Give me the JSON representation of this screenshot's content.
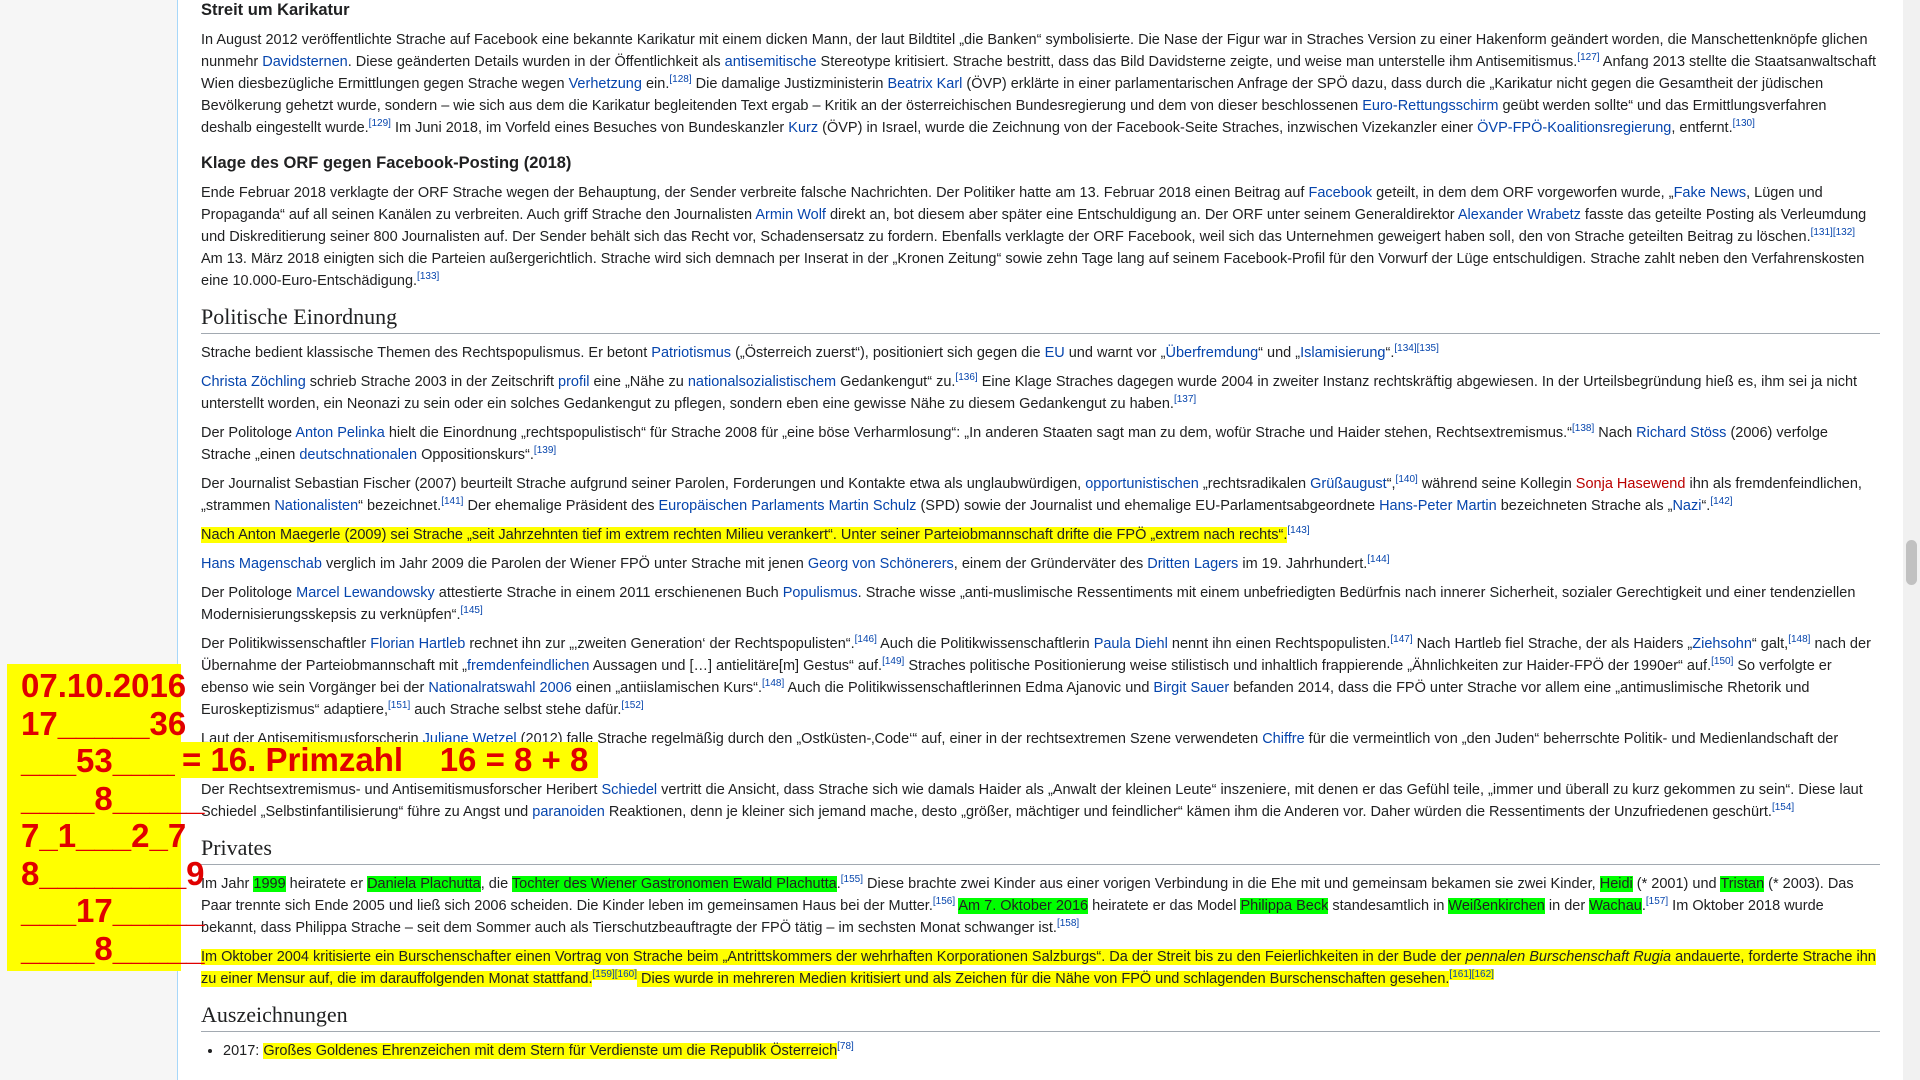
{
  "sections": {
    "karikatur": {
      "title": "Streit um Karikatur",
      "p1": [
        {
          "t": "In August 2012 veröffentlichte Strache auf Facebook eine bekannte Karikatur mit einem dicken Mann, der laut Bildtitel „die Banken“ symbolisierte. Die Nase der Figur war in Straches Version zu einer Hakenform geändert worden, die Manschettenknöpfe glichen nunmehr "
        },
        {
          "t": "Davidsternen",
          "l": 1
        },
        {
          "t": ". Diese geänderten Details wurden in der Öffentlichkeit als "
        },
        {
          "t": "antisemitische",
          "l": 1
        },
        {
          "t": " Stereotype kritisiert. Strache bestritt, dass das Bild Davidsterne zeigte, und weise man unterstelle ihm Antisemitismus."
        },
        {
          "t": "[127]",
          "s": 1
        },
        {
          "t": " Anfang 2013 stellte die Staatsanwaltschaft Wien diesbezügliche Ermittlungen gegen Strache wegen "
        },
        {
          "t": "Verhetzung",
          "l": 1
        },
        {
          "t": " ein."
        },
        {
          "t": "[128]",
          "s": 1
        },
        {
          "t": " Die damalige Justizministerin "
        },
        {
          "t": "Beatrix Karl",
          "l": 1
        },
        {
          "t": " (ÖVP) erklärte in einer parlamentarischen Anfrage der SPÖ dazu, dass durch die „Karikatur nicht gegen die Gesamtheit der jüdischen Bevölkerung gehetzt wurde, sondern – wie sich aus dem die Karikatur begleitenden Text ergab – Kritik an der österreichischen Bundesregierung und dem von dieser beschlossenen "
        },
        {
          "t": "Euro-Rettungsschirm",
          "l": 1
        },
        {
          "t": " geübt werden sollte“ und das Ermittlungsverfahren deshalb eingestellt wurde."
        },
        {
          "t": "[129]",
          "s": 1
        },
        {
          "t": " Im Juni 2018, im Vorfeld eines Besuches von Bundeskanzler "
        },
        {
          "t": "Kurz",
          "l": 1
        },
        {
          "t": " (ÖVP) in Israel, wurde die Zeichnung von der Facebook-Seite Straches, inzwischen Vizekanzler einer "
        },
        {
          "t": "ÖVP-FPÖ-Koalitionsregierung",
          "l": 1
        },
        {
          "t": ", entfernt."
        },
        {
          "t": "[130]",
          "s": 1
        }
      ]
    },
    "orf": {
      "title": "Klage des ORF gegen Facebook-Posting (2018)",
      "p1": [
        {
          "t": "Ende Februar 2018 verklagte der ORF Strache wegen der Behauptung, der Sender verbreite falsche Nachrichten. Der Politiker hatte am 13. Februar 2018 einen Beitrag auf "
        },
        {
          "t": "Facebook",
          "l": 1
        },
        {
          "t": " geteilt, in dem dem ORF vorgeworfen wurde, „"
        },
        {
          "t": "Fake News",
          "l": 1
        },
        {
          "t": ", Lügen und Propaganda“ auf all seinen Kanälen zu verbreiten. Auch griff Strache den Journalisten "
        },
        {
          "t": "Armin Wolf",
          "l": 1
        },
        {
          "t": " direkt an, bot diesem aber später eine Entschuldigung an. Der ORF unter seinem Generaldirektor "
        },
        {
          "t": "Alexander Wrabetz",
          "l": 1
        },
        {
          "t": " fasste das geteilte Posting als Verleumdung und Diskreditierung seiner 800 Journalisten auf. Der Sender behält sich das Recht vor, Schadensersatz zu fordern. Ebenfalls verklagte der ORF Facebook, weil sich das Unternehmen geweigert haben soll, den von Strache geteilten Beitrag zu löschen."
        },
        {
          "t": "[131][132]",
          "s": 1
        },
        {
          "t": " Am 13. März 2018 einigten sich die Parteien außergerichtlich. Strache wird sich demnach per Inserat in der „Kronen Zeitung“ sowie zehn Tage lang auf seinem Facebook-Profil für den Vorwurf der Lüge entschuldigen. Strache zahlt neben den Verfahrenskosten eine 10.000-Euro-Entschädigung."
        },
        {
          "t": "[133]",
          "s": 1
        }
      ]
    },
    "politik": {
      "title": "Politische Einordnung",
      "paras": [
        [
          {
            "t": "Strache bedient klassische Themen des Rechtspopulismus. Er betont "
          },
          {
            "t": "Patriotismus",
            "l": 1
          },
          {
            "t": " („Österreich zuerst“), positioniert sich gegen die "
          },
          {
            "t": "EU",
            "l": 1
          },
          {
            "t": " und warnt vor „"
          },
          {
            "t": "Überfremdung",
            "l": 1
          },
          {
            "t": "“ und „"
          },
          {
            "t": "Islamisierung",
            "l": 1
          },
          {
            "t": "“."
          },
          {
            "t": "[134][135]",
            "s": 1
          }
        ],
        [
          {
            "t": "Christa Zöchling",
            "l": 1
          },
          {
            "t": " schrieb Strache 2003 in der Zeitschrift "
          },
          {
            "t": "profil",
            "l": 1
          },
          {
            "t": " eine „Nähe zu "
          },
          {
            "t": "nationalsozialistischem",
            "l": 1
          },
          {
            "t": " Gedankengut“ zu."
          },
          {
            "t": "[136]",
            "s": 1
          },
          {
            "t": " Eine Klage Straches dagegen wurde 2004 in zweiter Instanz rechtskräftig abgewiesen. In der Urteilsbegründung hieß es, ihm sei ja nicht unterstellt worden, ein Neonazi zu sein oder ein solches Gedankengut zu pflegen, sondern eben eine gewisse Nähe zu diesem Gedankengut zu haben."
          },
          {
            "t": "[137]",
            "s": 1
          }
        ],
        [
          {
            "t": "Der Politologe "
          },
          {
            "t": "Anton Pelinka",
            "l": 1
          },
          {
            "t": " hielt die Einordnung „rechtspopulistisch“ für Strache 2008 für „eine böse Verharmlosung“: „In anderen Staaten sagt man zu dem, wofür Strache und Haider stehen, Rechtsextremismus.“"
          },
          {
            "t": "[138]",
            "s": 1
          },
          {
            "t": " Nach "
          },
          {
            "t": "Richard Stöss",
            "l": 1
          },
          {
            "t": " (2006) verfolge Strache „einen "
          },
          {
            "t": "deutschnationalen",
            "l": 1
          },
          {
            "t": " Oppositionskurs“."
          },
          {
            "t": "[139]",
            "s": 1
          }
        ],
        [
          {
            "t": "Der Journalist Sebastian Fischer (2007) beurteilt Strache aufgrund seiner Parolen, Forderungen und Kontakte etwa als unglaubwürdigen, "
          },
          {
            "t": "opportunistischen",
            "l": 1
          },
          {
            "t": " „rechtsradikalen "
          },
          {
            "t": "Grüßaugust",
            "l": 1
          },
          {
            "t": "“,"
          },
          {
            "t": "[140]",
            "s": 1
          },
          {
            "t": " während seine Kollegin "
          },
          {
            "t": "Sonja Hasewend",
            "l": 1,
            "r": 1
          },
          {
            "t": " ihn als fremdenfeindlichen, „strammen "
          },
          {
            "t": "Nationalisten",
            "l": 1
          },
          {
            "t": "“ bezeichnet."
          },
          {
            "t": "[141]",
            "s": 1
          },
          {
            "t": " Der ehemalige Präsident des "
          },
          {
            "t": "Europäischen Parlaments",
            "l": 1
          },
          {
            "t": " "
          },
          {
            "t": "Martin Schulz",
            "l": 1
          },
          {
            "t": " (SPD) sowie der Journalist und ehemalige EU-Parlamentsabgeordnete "
          },
          {
            "t": "Hans-Peter Martin",
            "l": 1
          },
          {
            "t": " bezeichneten Strache als „"
          },
          {
            "t": "Nazi",
            "l": 1
          },
          {
            "t": "“."
          },
          {
            "t": "[142]",
            "s": 1
          }
        ],
        [
          {
            "t": "Nach Anton Maegerle (2009) sei Strache „seit Jahrzehnten tief im extrem rechten Milieu verankert“. Unter seiner Parteiobmannschaft drifte die FPÖ „extrem nach rechts“.",
            "h": "y"
          },
          {
            "t": "[143]",
            "s": 1
          }
        ],
        [
          {
            "t": "Hans Magenschab",
            "l": 1
          },
          {
            "t": " verglich im Jahr 2009 die Parolen der Wiener FPÖ unter Strache mit jenen "
          },
          {
            "t": "Georg von Schönerers",
            "l": 1
          },
          {
            "t": ", einem der Gründerväter des "
          },
          {
            "t": "Dritten Lagers",
            "l": 1
          },
          {
            "t": " im 19. Jahrhundert."
          },
          {
            "t": "[144]",
            "s": 1
          }
        ],
        [
          {
            "t": "Der Politologe "
          },
          {
            "t": "Marcel Lewandowsky",
            "l": 1
          },
          {
            "t": " attestierte Strache in einem 2011 erschienenen Buch "
          },
          {
            "t": "Populismus",
            "l": 1
          },
          {
            "t": ". Strache wisse „anti-muslimische Ressentiments mit einem unbefriedigten Bedürfnis nach innerer Sicherheit, sozialer Gerechtigkeit und einer tendenziellen Modernisierungsskepsis zu verknüpfen“."
          },
          {
            "t": "[145]",
            "s": 1
          }
        ],
        [
          {
            "t": "Der Politikwissenschaftler "
          },
          {
            "t": "Florian Hartleb",
            "l": 1
          },
          {
            "t": " rechnet ihn zur „‚zweiten Generation‘ der Rechtspopulisten“."
          },
          {
            "t": "[146]",
            "s": 1
          },
          {
            "t": " Auch die Politikwissenschaftlerin "
          },
          {
            "t": "Paula Diehl",
            "l": 1
          },
          {
            "t": " nennt ihn einen Rechtspopulisten."
          },
          {
            "t": "[147]",
            "s": 1
          },
          {
            "t": " Nach Hartleb fiel Strache, der als Haiders „"
          },
          {
            "t": "Ziehsohn",
            "l": 1
          },
          {
            "t": "“ galt,"
          },
          {
            "t": "[148]",
            "s": 1
          },
          {
            "t": " nach der Übernahme der Parteiobmannschaft mit „"
          },
          {
            "t": "fremdenfeindlichen",
            "l": 1
          },
          {
            "t": " Aussagen und […] antielitäre[m] Gestus“ auf."
          },
          {
            "t": "[149]",
            "s": 1
          },
          {
            "t": " Straches politische Positionierung weise stilistisch und inhaltlich frappierende „Ähnlichkeiten zur Haider-FPÖ der 1990er“ auf."
          },
          {
            "t": "[150]",
            "s": 1
          },
          {
            "t": " So verfolgte er ebenso wie sein Vorgänger bei der "
          },
          {
            "t": "Nationalratswahl 2006",
            "l": 1
          },
          {
            "t": " einen „antiislamischen Kurs“."
          },
          {
            "t": "[148]",
            "s": 1
          },
          {
            "t": " Auch die Politikwissenschaftlerinnen Edma Ajanovic und "
          },
          {
            "t": "Birgit Sauer",
            "l": 1
          },
          {
            "t": " befanden 2014, dass die FPÖ unter Strache vor allem eine „antimuslimische Rhetorik und Euroskeptizismus“ adaptiere,"
          },
          {
            "t": "[151]",
            "s": 1
          },
          {
            "t": " auch Strache selbst stehe dafür."
          },
          {
            "t": "[152]",
            "s": 1
          }
        ],
        [
          {
            "t": "Laut der Antisemitismusforscherin "
          },
          {
            "t": "Juliane Wetzel",
            "l": 1
          },
          {
            "t": " (2012) falle Strache regelmäßig durch den „Ostküsten-‚Code‘“ auf, einer in der rechtsextremen Szene verwendeten "
          },
          {
            "t": "Chiffre",
            "l": 1
          },
          {
            "t": " für die vermeintlich von „den Juden“ beherrschte Politik- und Medienlandschaft der Vereinigten Staaten."
          },
          {
            "t": "[153]",
            "s": 1
          }
        ],
        [
          {
            "t": "Der Rechtsextremismus- und Antisemitismusforscher Heribert "
          },
          {
            "t": "Schiedel",
            "l": 1
          },
          {
            "t": " vertritt die Ansicht, dass Strache sich wie damals Haider als „Anwalt der kleinen Leute“ inszeniere, mit denen er das Gefühl teile, „immer und überall zu kurz gekommen zu sein“. Diese laut Schiedel „Selbstinfantilisierung“ führe zu Angst und "
          },
          {
            "t": "paranoiden",
            "l": 1
          },
          {
            "t": " Reaktionen, denn je kleiner sich jemand mache, desto „größer, mächtiger und feindlicher“ kämen ihm die Anderen vor. Daher würden die Ressentiments der Unzufriedenen geschürt."
          },
          {
            "t": "[154]",
            "s": 1
          }
        ]
      ]
    },
    "privates": {
      "title": "Privates",
      "paras": [
        [
          {
            "t": "Im Jahr "
          },
          {
            "t": "1999",
            "h": "g"
          },
          {
            "t": " heiratete er "
          },
          {
            "t": "Daniela Plachutta",
            "h": "g"
          },
          {
            "t": ", die "
          },
          {
            "t": "Tochter des Wiener Gastronomen Ewald Plachutta",
            "h": "g"
          },
          {
            "t": "."
          },
          {
            "t": "[155]",
            "s": 1
          },
          {
            "t": " Diese brachte zwei Kinder aus einer vorigen Verbindung in die Ehe mit und gemeinsam bekamen sie zwei Kinder, "
          },
          {
            "t": "Heidi",
            "h": "g"
          },
          {
            "t": " (* 2001) und "
          },
          {
            "t": "Tristan",
            "h": "g"
          },
          {
            "t": " (* 2003). Das Paar trennte sich Ende 2005 und ließ sich 2006 scheiden. Die Kinder leben im gemeinsamen Haus bei der Mutter."
          },
          {
            "t": "[156]",
            "s": 1
          },
          {
            "t": " "
          },
          {
            "t": "Am 7. Oktober 2016",
            "h": "g"
          },
          {
            "t": " heiratete er das Model "
          },
          {
            "t": "Philippa Beck",
            "h": "g"
          },
          {
            "t": " standesamtlich in "
          },
          {
            "t": "Weißenkirchen",
            "h": "g"
          },
          {
            "t": " in der "
          },
          {
            "t": "Wachau",
            "h": "g"
          },
          {
            "t": "."
          },
          {
            "t": "[157]",
            "s": 1
          },
          {
            "t": " Im Oktober 2018 wurde bekannt, dass Philippa Strache – seit dem Sommer auch als Tierschutzbeauftragte der FPÖ tätig – im sechsten Monat schwanger ist."
          },
          {
            "t": "[158]",
            "s": 1
          }
        ],
        [
          {
            "t": "Im Oktober 2004 kritisierte ein Burschenschafter einen Vortrag von Strache beim „Antrittskommers der wehrhaften Korporationen Salzburgs“. Da der Streit bis zu den Feierlichkeiten in der Bude der ",
            "h": "y"
          },
          {
            "t": "pennalen Burschenschaft Rugia",
            "h": "y",
            "i": 1
          },
          {
            "t": " andauerte, forderte Strache ihn zu einer Mensur auf, die im darauffolgenden Monat stattfand.",
            "h": "y"
          },
          {
            "t": "[159][160]",
            "s": 1,
            "h": "y"
          },
          {
            "t": " Dies wurde in mehreren Medien kritisiert und als Zeichen für die Nähe von FPÖ und schlagenden Burschenschaften gesehen.",
            "h": "y"
          },
          {
            "t": "[161][162]",
            "s": 1,
            "h": "y"
          }
        ]
      ]
    },
    "auszeichnungen": {
      "title": "Auszeichnungen",
      "items": [
        [
          {
            "t": "2017: "
          },
          {
            "t": "Großes Goldenes Ehrenzeichen mit dem Stern für Verdienste um die Republik Österreich",
            "h": "y"
          },
          {
            "t": "[78]",
            "s": 1
          }
        ]
      ]
    }
  },
  "notes": {
    "lines": [
      "07.10.2016",
      "17_____36",
      "___53_____",
      "____8_____",
      "7_1___2_7",
      "8________9",
      "___17_____",
      "____8_____"
    ],
    "primzahl": "= 16. Primzahl    16 = 8 + 8"
  },
  "colors": {
    "link": "#0645ad",
    "redlink": "#ba0000",
    "highlight_yellow": "#ffff00",
    "highlight_green": "#00ff00",
    "annotation_red": "#e00000"
  }
}
